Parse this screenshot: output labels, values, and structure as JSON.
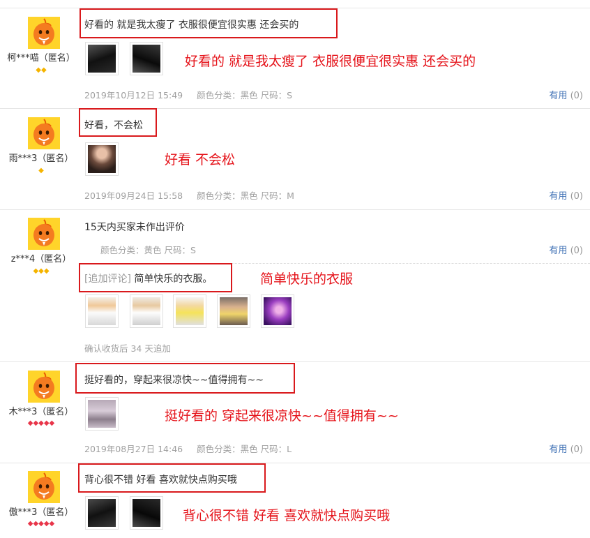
{
  "colors": {
    "highlight_red": "#d9191c",
    "annotation_red": "#e5141b",
    "link_blue": "#3d6fb4",
    "muted_gray": "#a0a0a0",
    "gem_gold": "#f5b400",
    "gem_red": "#e8364a"
  },
  "reviews": [
    {
      "username": "柯***喵（匿名）",
      "level_icon": "gold-diamond",
      "level_count": 2,
      "comment": "好看的 就是我太瘦了 衣服很便宜很实惠 还会买的",
      "annotation": "好看的 就是我太瘦了 衣服很便宜很实惠 还会买的",
      "photo_count": 2,
      "date": "2019年10月12日 15:49",
      "sku": "颜色分类：黑色  尺码：S",
      "useful_label": "有用",
      "useful_count": "(0)"
    },
    {
      "username": "雨***3（匿名）",
      "level_icon": "gold-diamond",
      "level_count": 1,
      "comment": "好看，不会松",
      "annotation": "好看  不会松",
      "photo_count": 1,
      "date": "2019年09月24日 15:58",
      "sku": "颜色分类：黑色  尺码：M",
      "useful_label": "有用",
      "useful_count": "(0)"
    },
    {
      "username": "z***4（匿名）",
      "level_icon": "gold-diamond",
      "level_count": 3,
      "comment": "15天内买家未作出评价",
      "sku": "颜色分类：黄色  尺码：S",
      "useful_label": "有用",
      "useful_count": "(0)",
      "append_tag": "[追加评论]",
      "append_text": "简单快乐的衣服。",
      "annotation": "简单快乐的衣服",
      "photo_count": 5,
      "append_time": "确认收货后 34 天追加"
    },
    {
      "username": "木***3（匿名）",
      "level_icon": "red-diamond",
      "level_count": 5,
      "comment": "挺好看的，穿起来很凉快~~值得拥有~~",
      "annotation": "挺好看的 穿起来很凉快~~值得拥有~~",
      "photo_count": 1,
      "date": "2019年08月27日 14:46",
      "sku": "颜色分类：黑色  尺码：L",
      "useful_label": "有用",
      "useful_count": "(0)"
    },
    {
      "username": "傲***3（匿名）",
      "level_icon": "red-diamond",
      "level_count": 5,
      "comment": "背心很不错 好看 喜欢就快点购买哦",
      "annotation": "背心很不错 好看 喜欢就快点购买哦",
      "photo_count": 2
    }
  ]
}
